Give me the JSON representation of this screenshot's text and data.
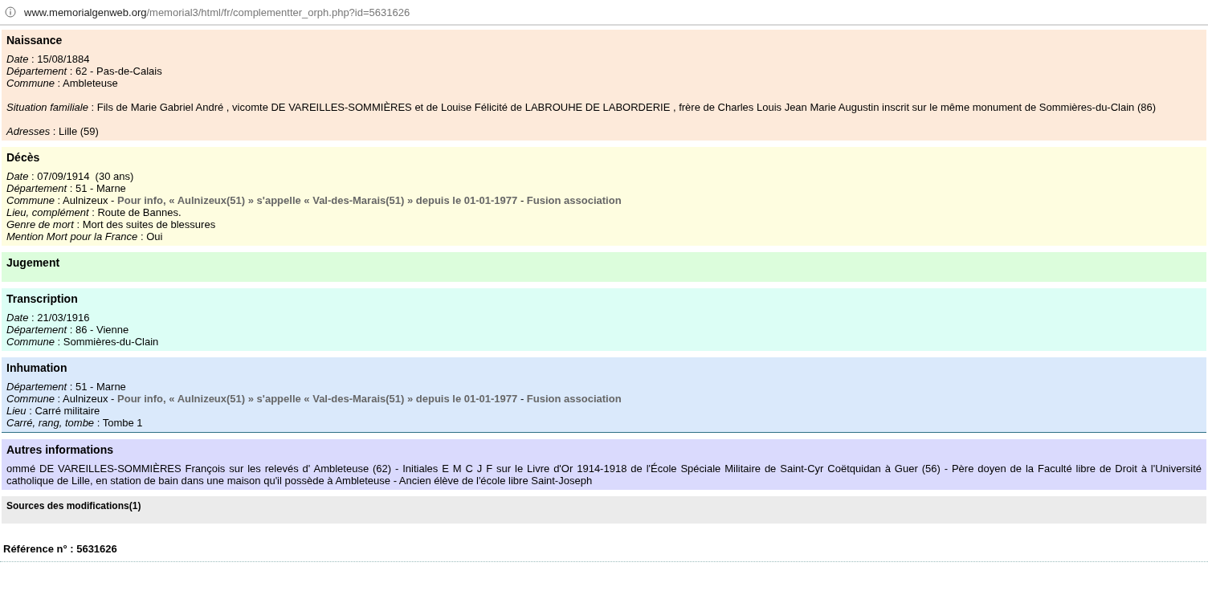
{
  "address_bar": {
    "domain": "www.memorialgenweb.org",
    "path": "/memorial3/html/fr/complementter_orph.php?id=5631626"
  },
  "sections": [
    {
      "title": "Naissance",
      "color": "#fdeada",
      "groups": [
        [
          "*Date* : 15/08/1884",
          "*Département* : 62 - Pas-de-Calais",
          "*Commune* : Ambleteuse"
        ],
        [
          "*Situation familiale* : Fils de Marie Gabriel André , vicomte DE VAREILLES-SOMMIÈRES et de Louise Félicité de LABROUHE DE LABORDERIE , frère de Charles Louis Jean Marie Augustin inscrit sur le même monument de Sommières-du-Clain (86)"
        ],
        [
          "*Adresses* : Lille (59)"
        ]
      ]
    },
    {
      "title": "Décès",
      "color": "#fefde0",
      "groups": [
        [
          "*Date* : 07/09/1914  (30 ans)",
          "*Département* : 51 - Marne",
          "*Commune* : Aulnizeux - **Pour info, « Aulnizeux(51) » s'appelle « Val-des-Marais(51) » depuis le 01-01-1977** - **Fusion association**",
          "*Lieu, complément* : Route de Bannes.",
          "*Genre de mort* : Mort des suites de blessures",
          "*Mention Mort pour la France* : Oui"
        ]
      ]
    },
    {
      "title": "Jugement",
      "color": "#dcfddc"
    },
    {
      "title": "Transcription",
      "color": "#dcfef5",
      "groups": [
        [
          "*Date* : 21/03/1916",
          "*Département* : 86 - Vienne",
          "*Commune* : Sommières-du-Clain"
        ]
      ]
    },
    {
      "title": "Inhumation",
      "color": "#dae9fb",
      "groups": [
        [
          "*Département* : 51 - Marne",
          "*Commune* : Aulnizeux - **Pour info, « Aulnizeux(51) » s'appelle « Val-des-Marais(51) » depuis le 01-01-1977** - **Fusion association**",
          "*Lieu* : Carré militaire",
          "*Carré, rang, tombe* : Tombe 1"
        ]
      ]
    },
    {
      "title": "Autres informations",
      "color": "#dadafd",
      "groups": [
        [
          "ommé DE VAREILLES-SOMMIÈRES François sur les relevés d' Ambleteuse (62) - Initiales E M C J F sur le Livre d'Or 1914-1918 de l'École Spéciale Militaire de Saint-Cyr Coëtquidan à Guer (56) - Père doyen de la Faculté libre de Droit à l'Université catholique de Lille, en station de bain dans une maison qu'il possède à Ambleteuse - Ancien élève de l'école libre Saint-Joseph"
        ]
      ]
    }
  ],
  "sources": {
    "title": "Sources des modifications(1)"
  },
  "reference": "Référence n° : 5631626"
}
